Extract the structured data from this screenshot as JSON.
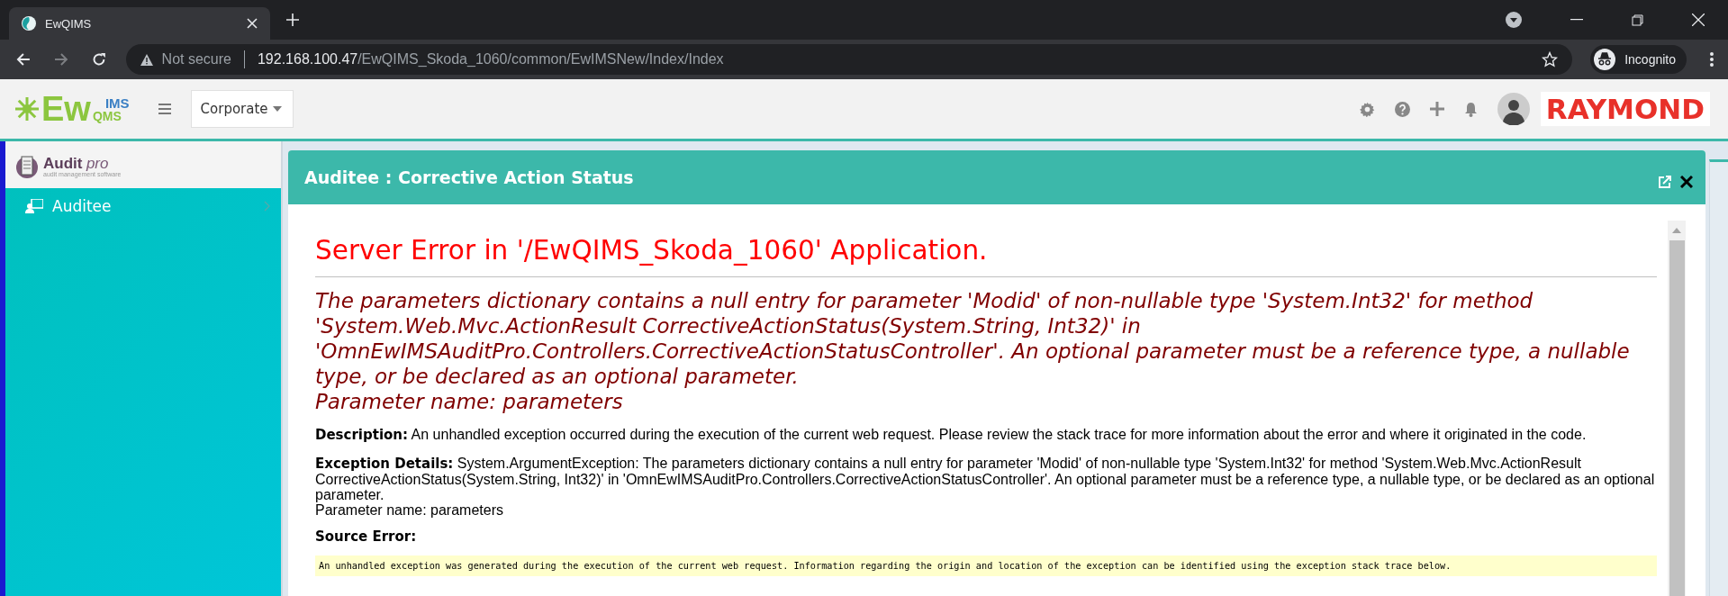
{
  "browser": {
    "tab_title": "EwQIMS",
    "security": "Not secure",
    "url_host": "192.168.100.47",
    "url_path": "/EwQIMS_Skoda_1060/common/EwIMSNew/Index/Index",
    "profile": "Incognito"
  },
  "header": {
    "logo": {
      "main": "Ew",
      "top": "IMS",
      "bottom": "QMS"
    },
    "company_select": {
      "value": "Corporate"
    },
    "brand": "RAYMOND"
  },
  "sidebar": {
    "logo": {
      "name": "Audit",
      "suffix": "pro",
      "tagline": "audit management software"
    },
    "items": [
      {
        "label": "Auditee"
      }
    ]
  },
  "panel": {
    "title": "Auditee : Corrective Action Status"
  },
  "error": {
    "title": "Server Error in '/EwQIMS_Skoda_1060' Application.",
    "message": "The parameters dictionary contains a null entry for parameter 'Modid' of non-nullable type 'System.Int32' for method 'System.Web.Mvc.ActionResult CorrectiveActionStatus(System.String, Int32)' in 'OmnEwIMSAuditPro.Controllers.CorrectiveActionStatusController'. An optional parameter must be a reference type, a nullable type, or be declared as an optional parameter.",
    "message_param": "Parameter name: parameters",
    "description": "**Description:** An unhandled exception occurred during the execution of the current web request. Please review the stack trace for more information about the error and where it originated in the code.",
    "details": "**Exception Details:** System.ArgumentException: The parameters dictionary contains a null entry for parameter 'Modid' of non-nullable type 'System.Int32' for method 'System.Web.Mvc.ActionResult CorrectiveActionStatus(System.String, Int32)' in 'OmnEwIMSAuditPro.Controllers.CorrectiveActionStatusController'. An optional parameter must be a reference type, a nullable type, or be declared as an optional parameter.",
    "details_param": "Parameter name: parameters",
    "source_heading": "Source Error:",
    "source_text": "An unhandled exception was generated during the execution of the current web request. Information regarding the origin and location of the exception can be identified using the exception stack trace below."
  }
}
